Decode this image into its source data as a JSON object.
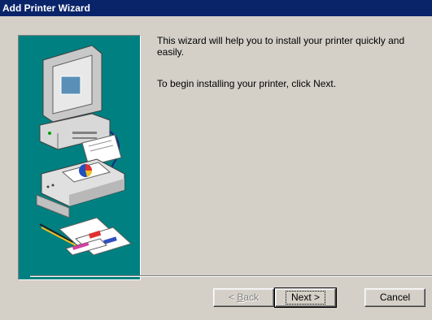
{
  "window": {
    "title": "Add Printer Wizard"
  },
  "content": {
    "intro": "This wizard will help you to install your printer quickly and easily.",
    "instruction": "To begin installing your printer, click Next."
  },
  "buttons": {
    "back": {
      "mnemonic_prefix": "< ",
      "mnemonic": "B",
      "rest": "ack"
    },
    "next": {
      "label": "Next >"
    },
    "cancel": {
      "label": "Cancel"
    }
  },
  "colors": {
    "titlebar": "#0a246a",
    "dialog_bg": "#d4d0c8",
    "illustration_bg": "#008080"
  },
  "icons": [
    "computer-icon",
    "printer-icon",
    "documents-icon"
  ]
}
